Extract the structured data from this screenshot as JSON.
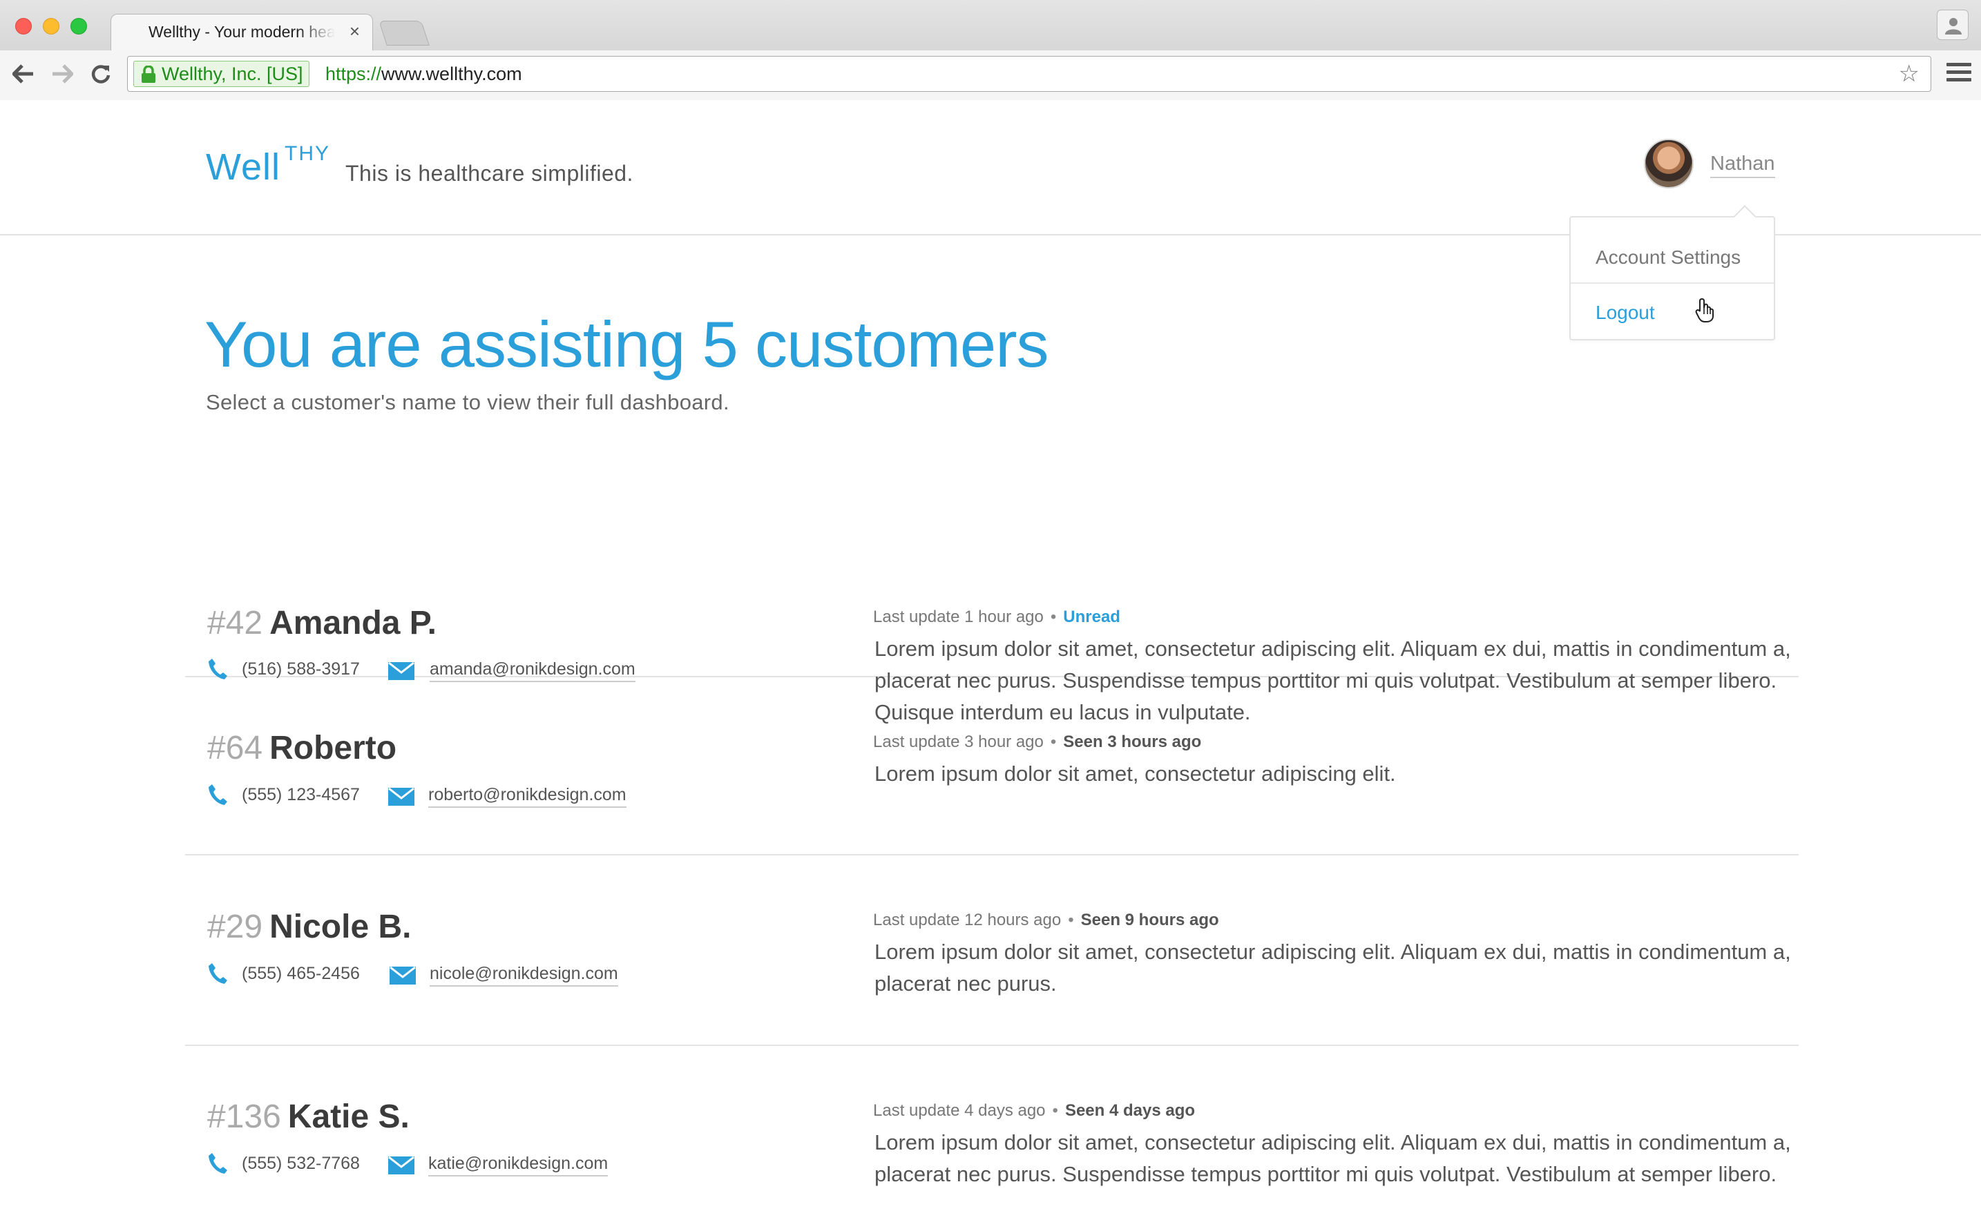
{
  "browser": {
    "tab_title": "Wellthy - Your modern hea",
    "tab_close": "×",
    "ev_label": "Wellthy, Inc. [US]",
    "url_scheme": "https://",
    "url_host": "www.wellthy.com",
    "star": "☆"
  },
  "header": {
    "logo_main": "Well",
    "logo_sup": "THY",
    "tagline": "This is healthcare simplified.",
    "user_name": "Nathan"
  },
  "dropdown": {
    "account_settings": "Account Settings",
    "logout": "Logout"
  },
  "main": {
    "headline": "You are assisting 5 customers",
    "subhead": "Select a customer's name to view their full dashboard."
  },
  "accent_color": "#2b9fd9",
  "customers": [
    {
      "number": "#42",
      "name": "Amanda P.",
      "phone": "(516) 588-3917",
      "email": "amanda@ronikdesign.com",
      "last_update": "Last update 1 hour ago",
      "status": "Unread",
      "message": "Lorem ipsum dolor sit amet, consectetur adipiscing elit. Aliquam ex dui, mattis in condimentum a, placerat nec purus. Suspendisse tempus porttitor mi quis volutpat. Vestibulum at semper libero. Quisque interdum eu lacus in vulputate."
    },
    {
      "number": "#64",
      "name": "Roberto",
      "phone": "(555) 123-4567",
      "email": "roberto@ronikdesign.com",
      "last_update": "Last update 3 hour ago",
      "status": "Seen 3 hours ago",
      "message": "Lorem ipsum dolor sit amet, consectetur adipiscing elit."
    },
    {
      "number": "#29",
      "name": "Nicole B.",
      "phone": "(555) 465-2456",
      "email": "nicole@ronikdesign.com",
      "last_update": "Last update 12 hours ago",
      "status": "Seen 9 hours ago",
      "message": "Lorem ipsum dolor sit amet, consectetur adipiscing elit. Aliquam ex dui, mattis in condimentum a, placerat nec purus."
    },
    {
      "number": "#136",
      "name": "Katie S.",
      "phone": "(555) 532-7768",
      "email": "katie@ronikdesign.com",
      "last_update": "Last update 4 days ago",
      "status": "Seen 4 days ago",
      "message": "Lorem ipsum dolor sit amet, consectetur adipiscing elit. Aliquam ex dui, mattis in condimentum a, placerat nec purus. Suspendisse tempus porttitor mi quis volutpat. Vestibulum at semper libero."
    }
  ]
}
